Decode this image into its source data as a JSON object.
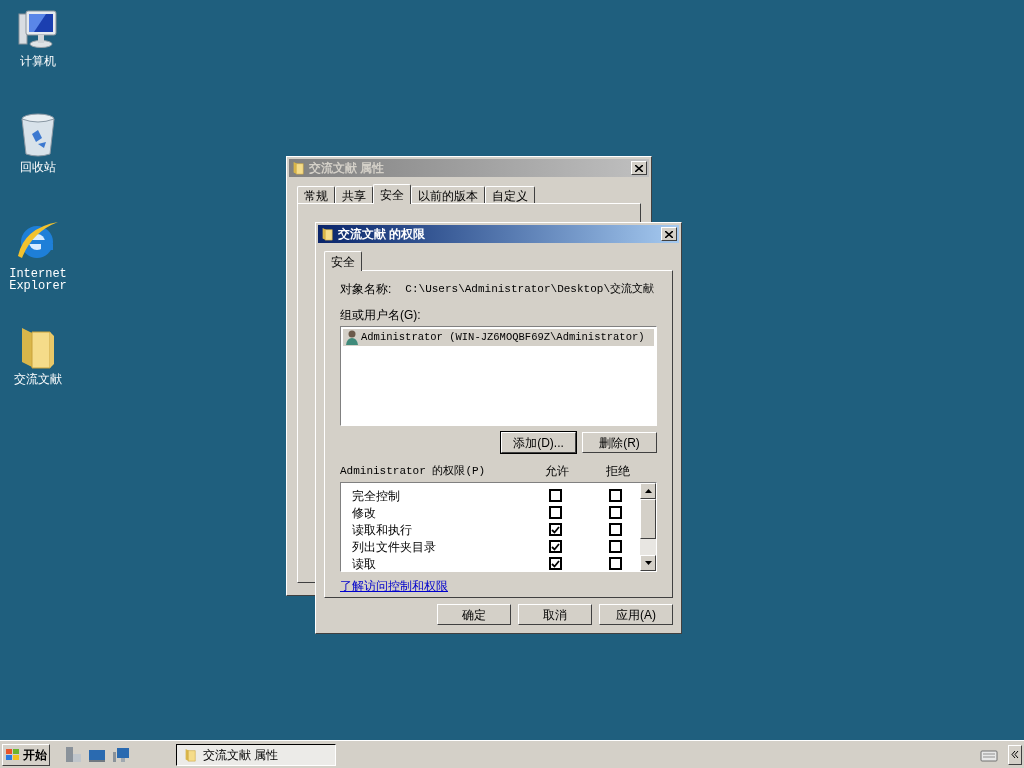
{
  "desktop_icons": [
    {
      "kind": "computer",
      "label": "计算机"
    },
    {
      "kind": "recycle-bin",
      "label": "回收站"
    },
    {
      "kind": "browser",
      "label": "Internet Explorer"
    },
    {
      "kind": "folder",
      "label": "交流文献"
    }
  ],
  "back_window": {
    "title": "交流文献 属性",
    "active": false,
    "tabs": [
      {
        "label": "常规",
        "selected": false
      },
      {
        "label": "共享",
        "selected": false
      },
      {
        "label": "安全",
        "selected": true
      },
      {
        "label": "以前的版本",
        "selected": false
      },
      {
        "label": "自定义",
        "selected": false
      }
    ]
  },
  "front_window": {
    "title": "交流文献 的权限",
    "active": true,
    "tabs": [
      {
        "label": "安全",
        "selected": true
      }
    ],
    "object_name_label": "对象名称:",
    "object_name": "C:\\Users\\Administrator\\Desktop\\交流文献",
    "group_label": "组或用户名(G):",
    "users": [
      {
        "name": "Administrator (WIN-JZ6MOQBF69Z\\Administrator)",
        "selected": true
      }
    ],
    "add_button": "添加(D)...",
    "remove_button": "删除(R)",
    "permissions_label": "Administrator 的权限(P)",
    "allow_header": "允许",
    "deny_header": "拒绝",
    "permissions": [
      {
        "name": "完全控制",
        "allow": false,
        "deny": false
      },
      {
        "name": "修改",
        "allow": false,
        "deny": false
      },
      {
        "name": "读取和执行",
        "allow": true,
        "deny": false
      },
      {
        "name": "列出文件夹目录",
        "allow": true,
        "deny": false
      },
      {
        "name": "读取",
        "allow": true,
        "deny": false
      }
    ],
    "link": "了解访问控制和权限",
    "buttons": [
      "确定",
      "取消",
      "应用(A)"
    ]
  },
  "taskbar": {
    "start_label": "开始",
    "tasks": [
      {
        "label": "交流文献 属性",
        "selected": true
      }
    ]
  }
}
